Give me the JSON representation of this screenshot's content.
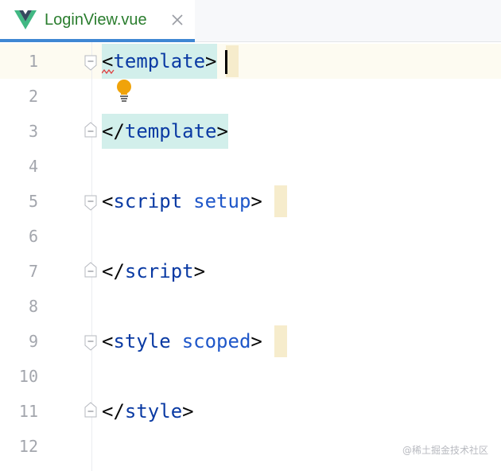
{
  "tab": {
    "filename": "LoginView.vue",
    "icon": "vue-logo-icon",
    "close_icon": "close-icon",
    "active_underline_color": "#3f87d3",
    "label_color": "#2a7d2e"
  },
  "editor": {
    "line_numbers": [
      "1",
      "2",
      "3",
      "4",
      "5",
      "6",
      "7",
      "8",
      "9",
      "10",
      "11",
      "12"
    ],
    "lines": {
      "l1": {
        "open": "<",
        "tag": "template",
        "close": ">"
      },
      "l3": {
        "open": "</",
        "tag": "template",
        "close": ">"
      },
      "l5": {
        "open": "<",
        "tag": "script",
        "attr": "setup",
        "close": ">"
      },
      "l7": {
        "open": "</",
        "tag": "script",
        "close": ">"
      },
      "l9": {
        "open": "<",
        "tag": "style",
        "attr": "scoped",
        "close": ">"
      },
      "l11": {
        "open": "</",
        "tag": "style",
        "close": ">"
      }
    },
    "colors": {
      "tag": "#0a3aa3",
      "attribute": "#1f57c9",
      "tag_match_highlight": "#d2efeb",
      "current_line": "#fdfbf1"
    },
    "gutter_icons": [
      "fold-icon",
      "lightbulb-icon"
    ]
  },
  "watermark": "@稀土掘金技术社区"
}
